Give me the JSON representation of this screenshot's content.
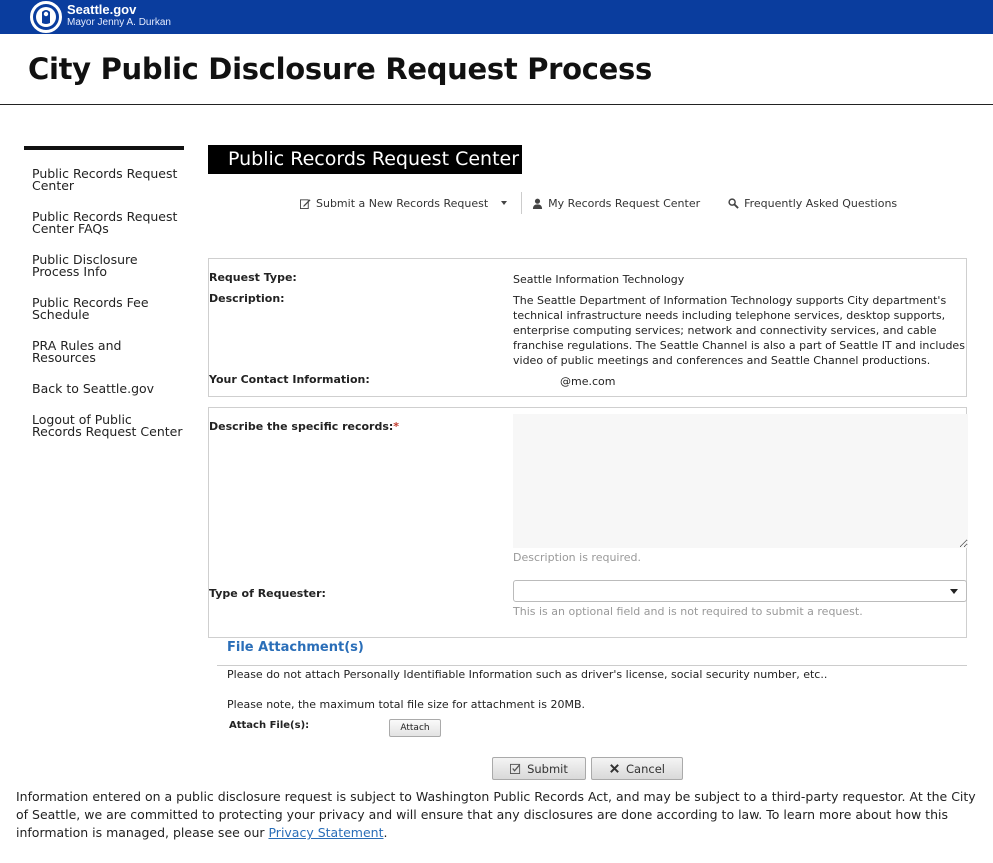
{
  "header": {
    "brand_title": "Seattle.gov",
    "brand_subtitle": "Mayor Jenny A. Durkan"
  },
  "page": {
    "title": "City Public Disclosure Request Process"
  },
  "sidebar": {
    "items": [
      {
        "label": "Public Records Request Center"
      },
      {
        "label": "Public Records Request Center FAQs"
      },
      {
        "label": "Public Disclosure Process Info"
      },
      {
        "label": "Public Records Fee Schedule"
      },
      {
        "label": "PRA Rules and Resources"
      },
      {
        "label": "Back to Seattle.gov"
      },
      {
        "label": "Logout of Public Records Request Center"
      }
    ]
  },
  "center": {
    "heading": "Public Records Request Center"
  },
  "nav": {
    "submit": "Submit a New Records Request",
    "my_center": "My Records Request Center",
    "faq": "Frequently Asked Questions"
  },
  "info": {
    "request_type_label": "Request Type:",
    "request_type_value": "Seattle Information Technology",
    "description_label": "Description:",
    "description_value": "The Seattle Department of Information Technology supports City department's technical infrastructure needs including telephone services, desktop supports, enterprise computing services; network and connectivity services, and cable franchise regulations.  The Seattle Channel is also a part of Seattle IT and includes video of public meetings and conferences and Seattle Channel productions.",
    "contact_label": "Your Contact Information:",
    "contact_value": "@me.com"
  },
  "form": {
    "records_label": "Describe the specific records:",
    "required_mark": "*",
    "records_value": "",
    "records_hint": "Description is required.",
    "requester_label": "Type of Requester:",
    "requester_value": "",
    "requester_hint": "This is an optional field and is not required to submit a request."
  },
  "attachments": {
    "title": "File Attachment(s)",
    "note1": "Please do not attach Personally Identifiable Information such as driver's license, social security number, etc..",
    "note2": "Please note, the maximum total file size for attachment is 20MB.",
    "attach_label": "Attach File(s):",
    "attach_button": "Attach"
  },
  "actions": {
    "submit": "Submit",
    "cancel": "Cancel"
  },
  "footer": {
    "text": "Information entered on a public disclosure request is subject to Washington Public Records Act, and may be subject to a third-party requestor. At the City of Seattle, we are committed to protecting your privacy and will ensure that any disclosures are done according to law. To learn more about how this information is managed, please see our ",
    "link": "Privacy Statement",
    "end": "."
  },
  "colors": {
    "topbar": "#0a3d9e",
    "link": "#2a6eb8",
    "required": "#c0392b"
  }
}
